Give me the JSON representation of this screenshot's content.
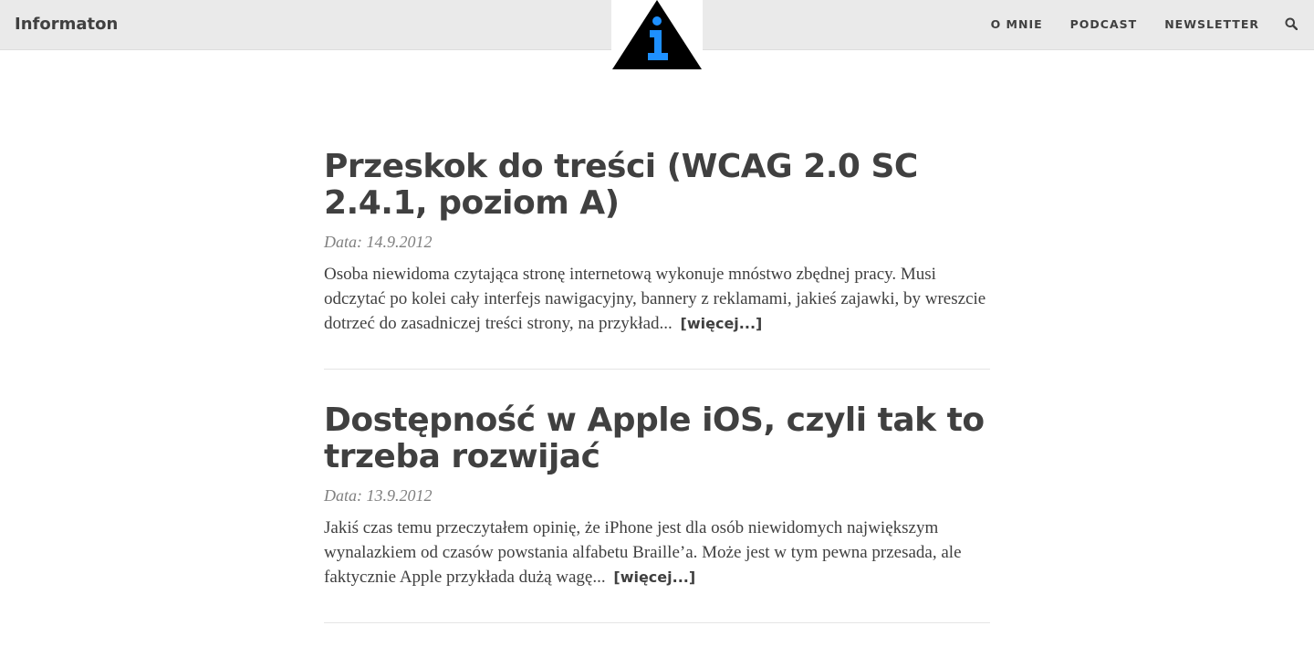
{
  "header": {
    "brand": "Informaton",
    "nav": [
      "O MNIE",
      "PODCAST",
      "NEWSLETTER"
    ],
    "search_icon": "search-icon",
    "logo_icon": "info-triangle-logo",
    "colors": {
      "navbar_bg": "#eaeaea",
      "logo_accent": "#1e90ff",
      "logo_dark": "#000000"
    }
  },
  "posts": [
    {
      "title": "Przeskok do treści (WCAG 2.0 SC 2.4.1, poziom A)",
      "meta": "Data: 14.9.2012",
      "excerpt": "Osoba niewidoma czytająca stronę internetową wykonuje mnóstwo zbędnej pracy. Musi odczytać po kolei cały interfejs nawigacyjny, bannery z reklamami, jakieś zajawki, by wreszcie dotrzeć do zasadniczej treści strony, na przykład...",
      "more": "[więcej...]"
    },
    {
      "title": "Dostępność w Apple iOS, czyli tak to trzeba rozwijać",
      "meta": "Data: 13.9.2012",
      "excerpt": "Jakiś czas temu przeczytałem opinię, że iPhone jest dla osób niewidomych największym wynalazkiem od czasów powstania alfabetu Braille’a. Może jest w tym pewna przesada, ale faktycznie Apple przykłada dużą wagę...",
      "more": "[więcej...]"
    }
  ]
}
